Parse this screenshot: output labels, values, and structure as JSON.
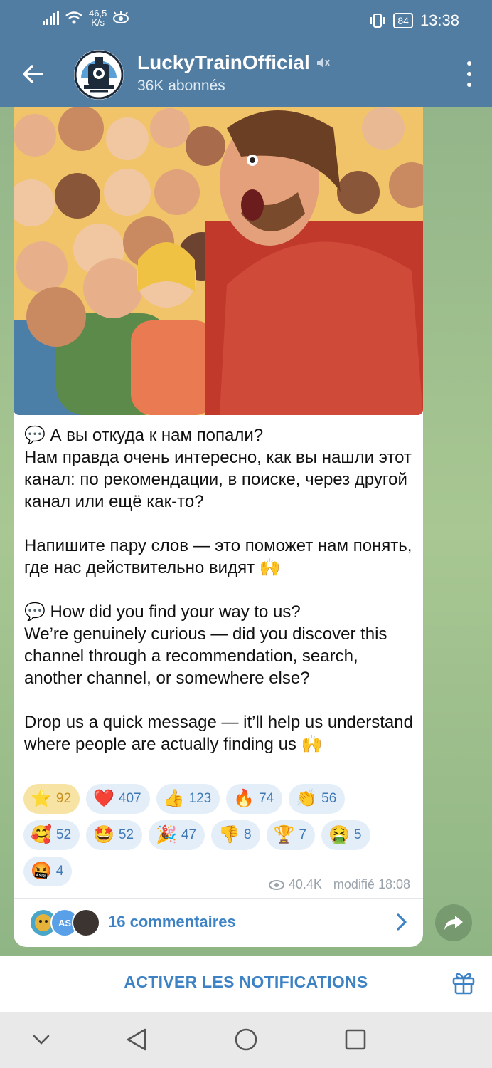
{
  "status_bar": {
    "speed": "46,5",
    "speed_unit": "K/s",
    "battery": "84",
    "time": "13:38"
  },
  "header": {
    "channel_name": "LuckyTrainOfficial",
    "subscribers": "36K abonnés"
  },
  "post": {
    "text": "💬 А вы откуда к нам попали?\nНам правда очень интересно, как вы нашли этот канал: по рекомендации, в поиске, через другой канал или ещё как-то?\n\nНапишите пару слов — это поможет нам понять, где нас действительно видят 🙌\n\n💬 How did you find your way to us?\nWe’re genuinely curious — did you discover this channel through a recommendation, search, another channel, or somewhere else?\n\nDrop us a quick message — it’ll help us understand where people are actually finding us 🙌",
    "reactions": [
      {
        "emoji": "⭐",
        "count": "92",
        "active": true
      },
      {
        "emoji": "❤️",
        "count": "407"
      },
      {
        "emoji": "👍",
        "count": "123"
      },
      {
        "emoji": "🔥",
        "count": "74"
      },
      {
        "emoji": "👏",
        "count": "56"
      },
      {
        "emoji": "🥰",
        "count": "52"
      },
      {
        "emoji": "🤩",
        "count": "52"
      },
      {
        "emoji": "🎉",
        "count": "47"
      },
      {
        "emoji": "👎",
        "count": "8"
      },
      {
        "emoji": "🏆",
        "count": "7"
      },
      {
        "emoji": "🤮",
        "count": "5"
      },
      {
        "emoji": "🤬",
        "count": "4"
      }
    ],
    "views": "40.4K",
    "edited": "modifié 18:08",
    "comments_label": "16 commentaires",
    "commenter_initials": "AS"
  },
  "bottom": {
    "notifications_label": "ACTIVER LES NOTIFICATIONS"
  },
  "icons": {
    "back": "arrow-left-icon",
    "mute": "muted-speaker-icon",
    "menu": "more-vertical-icon",
    "views": "eye-icon",
    "chevron": "chevron-right-icon",
    "share": "share-arrow-icon",
    "gift": "gift-icon"
  },
  "colors": {
    "header": "#517da2",
    "accent": "#3d82c4",
    "star_reaction": "#f7e3a3"
  }
}
